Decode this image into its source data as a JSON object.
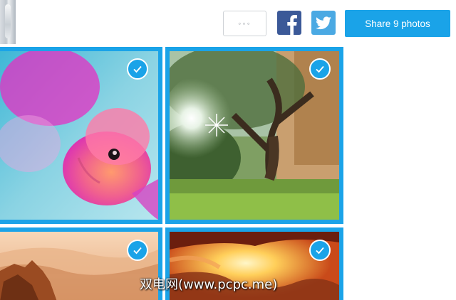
{
  "header": {
    "thumbnail": "thumbnail-image",
    "more_label": "◦◦◦",
    "share_label": "Share 9 photos",
    "facebook_icon": "facebook-icon",
    "twitter_icon": "twitter-icon"
  },
  "photos": [
    {
      "subject": "pink fish",
      "selected": true
    },
    {
      "subject": "forest tree with sun",
      "selected": true
    },
    {
      "subject": "canyon sunset",
      "selected": true
    },
    {
      "subject": "slot canyon light",
      "selected": true
    }
  ],
  "colors": {
    "accent": "#1aa3e8",
    "facebook": "#3b5998",
    "twitter": "#4aa9e3"
  },
  "watermark": "双电网(www.pcpc.me)"
}
